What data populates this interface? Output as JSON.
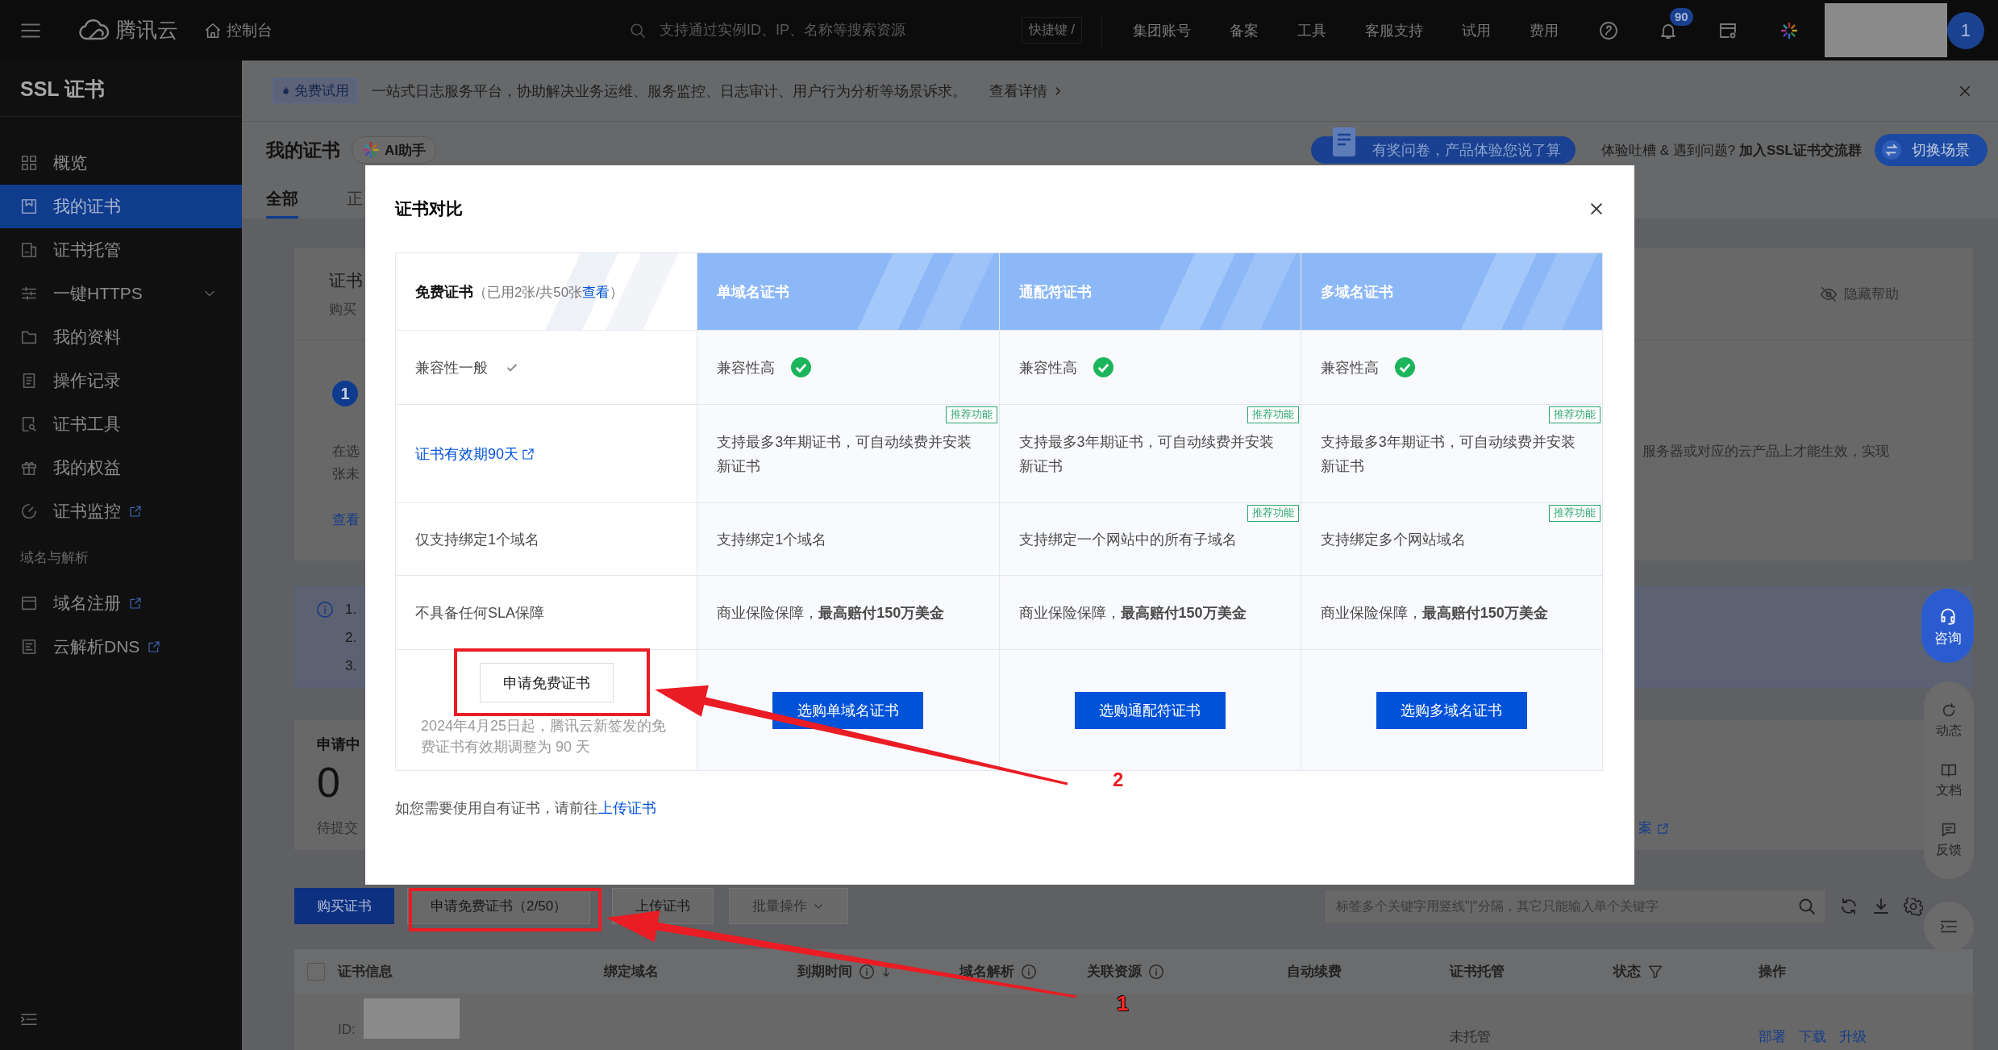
{
  "top_bar": {
    "brand": "腾讯云",
    "console": "控制台",
    "search": {
      "placeholder": "支持通过实例ID、IP、名称等搜索资源"
    },
    "shortcut": "快捷键 /",
    "nav": [
      "集团账号",
      "备案",
      "工具",
      "客服支持",
      "试用",
      "费用"
    ],
    "notification_count": "90",
    "avatar": "1"
  },
  "sidebar": {
    "title": "SSL 证书",
    "items": [
      {
        "label": "概览",
        "kind": "page",
        "selected": false
      },
      {
        "label": "我的证书",
        "kind": "page",
        "selected": true
      },
      {
        "label": "证书托管",
        "kind": "page",
        "selected": false
      },
      {
        "label": "一键HTTPS",
        "kind": "group",
        "selected": false
      },
      {
        "label": "我的资料",
        "kind": "page",
        "selected": false
      },
      {
        "label": "操作记录",
        "kind": "page",
        "selected": false
      },
      {
        "label": "证书工具",
        "kind": "page",
        "selected": false
      },
      {
        "label": "我的权益",
        "kind": "page",
        "selected": false
      },
      {
        "label": "证书监控",
        "kind": "external",
        "selected": false
      }
    ],
    "section": {
      "title": "域名与解析",
      "items": [
        {
          "label": "域名注册",
          "kind": "external",
          "selected": false
        },
        {
          "label": "云解析DNS",
          "kind": "external",
          "selected": false
        }
      ]
    }
  },
  "banner": {
    "tag": "免费试用",
    "text": "一站式日志服务平台，协助解决业务运维、服务监控、日志审计、用户行为分析等场景诉求。",
    "link": "查看详情"
  },
  "header": {
    "title": "我的证书",
    "assistant": "AI助手",
    "survey": "有奖问卷，产品体验您说了算",
    "feedback": "体验吐槽 & 遇到问题? **加入SSL证书交流群**",
    "switch_scene": "切换场景"
  },
  "tabs": [
    {
      "label": "全部",
      "selected": true
    },
    {
      "label": "正",
      "selected": false
    }
  ],
  "guide": {
    "title": "证书",
    "subtitle": "购买",
    "hide_help": "隐藏帮助",
    "step": "1",
    "lines": [
      "在选",
      "张未"
    ],
    "line_tail": "服务器或对应的云产品上才能生效，实现",
    "link": "查看"
  },
  "notice": {
    "items": [
      "1.",
      "2.",
      "3."
    ]
  },
  "stats": {
    "label": "申请中",
    "value": "0",
    "caption": "待提交",
    "link_tail": "案"
  },
  "toolbar": {
    "buttons": [
      {
        "label": "购买证书",
        "kind": "primary",
        "disabled": false
      },
      {
        "label": "申请免费证书（2/50）",
        "kind": "default",
        "disabled": false
      },
      {
        "label": "上传证书",
        "kind": "default",
        "disabled": false
      },
      {
        "label": "批量操作",
        "kind": "dropdown",
        "disabled": true
      }
    ],
    "search": {
      "placeholder": "标签多个关键字用竖线\"|\"分隔，其它只能输入单个关键字"
    }
  },
  "table": {
    "select_all": {
      "checked": false
    },
    "columns": [
      {
        "label": "证书信息",
        "kind": "plain"
      },
      {
        "label": "绑定域名",
        "kind": "plain"
      },
      {
        "label": "到期时间",
        "kind": "sortable"
      },
      {
        "label": "域名解析",
        "kind": "info"
      },
      {
        "label": "关联资源",
        "kind": "info"
      },
      {
        "label": "自动续费",
        "kind": "plain"
      },
      {
        "label": "证书托管",
        "kind": "plain"
      },
      {
        "label": "状态",
        "kind": "filter"
      },
      {
        "label": "操作",
        "kind": "plain"
      }
    ],
    "rows": [
      {
        "id_label": "ID:",
        "hosting": "未托管",
        "actions": [
          "部署",
          "下载",
          "升级"
        ]
      }
    ]
  },
  "floating": {
    "consult": "咨询",
    "tools": [
      "动态",
      "文档",
      "反馈"
    ]
  },
  "modal": {
    "title": "证书对比",
    "columns": [
      {
        "kind": "free",
        "name": "免费证书",
        "note": "（已用2张/共50张",
        "link": "查看",
        "note_end": "）"
      },
      {
        "kind": "paid",
        "name": "单域名证书"
      },
      {
        "kind": "paid",
        "name": "通配符证书"
      },
      {
        "kind": "paid",
        "name": "多域名证书"
      }
    ],
    "rows": [
      {
        "cells": [
          {
            "kind": "tick",
            "text": "兼容性一般"
          },
          {
            "kind": "circletick",
            "text": "兼容性高"
          },
          {
            "kind": "circletick",
            "text": "兼容性高"
          },
          {
            "kind": "circletick",
            "text": "兼容性高"
          }
        ]
      },
      {
        "cells": [
          {
            "kind": "link",
            "text": "证书有效期90天"
          },
          {
            "kind": "text",
            "text": "支持最多3年期证书，可自动续费并安装新证书",
            "tag": "推荐功能"
          },
          {
            "kind": "text",
            "text": "支持最多3年期证书，可自动续费并安装新证书",
            "tag": "推荐功能"
          },
          {
            "kind": "text",
            "text": "支持最多3年期证书，可自动续费并安装新证书",
            "tag": "推荐功能"
          }
        ]
      },
      {
        "cells": [
          {
            "kind": "text",
            "text": "仅支持绑定1个域名"
          },
          {
            "kind": "text",
            "text": "支持绑定1个域名"
          },
          {
            "kind": "text",
            "text": "支持绑定一个网站中的所有子域名",
            "tag": "推荐功能"
          },
          {
            "kind": "text",
            "text": "支持绑定多个网站域名",
            "tag": "推荐功能"
          }
        ]
      },
      {
        "cells": [
          {
            "kind": "text",
            "text": "不具备任何SLA保障"
          },
          {
            "kind": "text",
            "text": "商业保险保障，**最高赔付150万美金**"
          },
          {
            "kind": "text",
            "text": "商业保险保障，**最高赔付150万美金**"
          },
          {
            "kind": "text",
            "text": "商业保险保障，**最高赔付150万美金**"
          }
        ]
      },
      {
        "cells": [
          {
            "kind": "secondary",
            "button": "申请免费证书",
            "note": "2024年4月25日起，腾讯云新签发的免费证书有效期调整为 90 天"
          },
          {
            "kind": "primary",
            "button": "选购单域名证书"
          },
          {
            "kind": "primary",
            "button": "选购通配符证书"
          },
          {
            "kind": "primary",
            "button": "选购多域名证书"
          }
        ]
      }
    ],
    "footer": {
      "text": "如您需要使用自有证书，请前往",
      "link": "上传证书"
    }
  },
  "annotations": [
    {
      "label": "2"
    },
    {
      "label": "1"
    }
  ]
}
